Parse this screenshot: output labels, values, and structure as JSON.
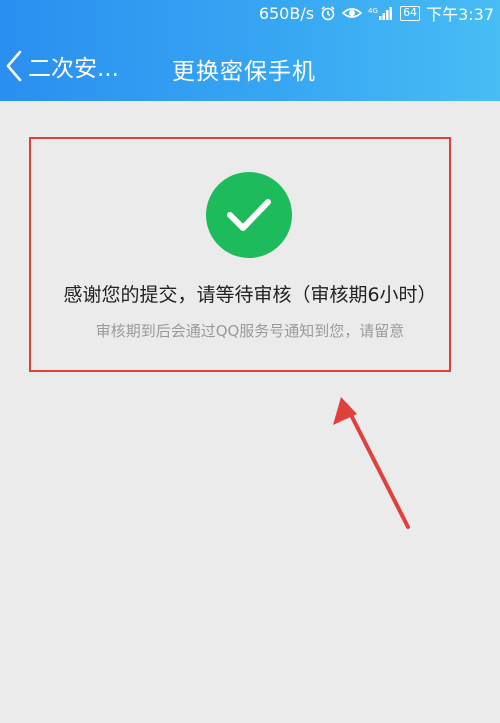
{
  "status_bar": {
    "net_speed": "650B/s",
    "network": "4G",
    "battery": "64",
    "time": "下午3:37",
    "icons": [
      "alarm-icon",
      "eye-icon",
      "signal-icon",
      "battery-icon"
    ]
  },
  "nav": {
    "back_label": "二次安...",
    "title": "更换密保手机"
  },
  "result": {
    "icon": "checkmark-icon",
    "message": "感谢您的提交，请等待审核（审核期6小时）",
    "note": "审核期到后会通过QQ服务号通知到您，请留意"
  },
  "colors": {
    "header_start": "#2a8ff0",
    "header_end": "#47bdf4",
    "success": "#1dbb5c",
    "highlight": "#e0403c",
    "background": "#ebebeb"
  }
}
